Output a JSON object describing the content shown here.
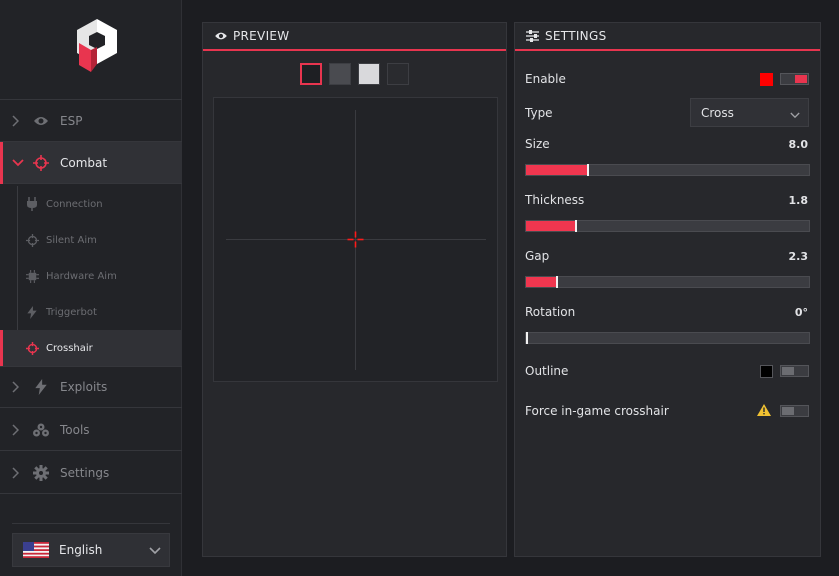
{
  "sidebar": {
    "nav": [
      {
        "label": "ESP",
        "icon": "eye-icon"
      },
      {
        "label": "Combat",
        "icon": "crosshair-icon"
      },
      {
        "label": "Exploits",
        "icon": "lightning-icon"
      },
      {
        "label": "Tools",
        "icon": "tools-icon"
      },
      {
        "label": "Settings",
        "icon": "gear-icon"
      }
    ],
    "combat_sub": [
      {
        "label": "Connection",
        "icon": "plug-icon"
      },
      {
        "label": "Silent Aim",
        "icon": "target-icon"
      },
      {
        "label": "Hardware Aim",
        "icon": "chip-icon"
      },
      {
        "label": "Triggerbot",
        "icon": "lightning-icon"
      },
      {
        "label": "Crosshair",
        "icon": "crosshair-icon"
      }
    ],
    "language": {
      "label": "English",
      "flag": "us-flag-icon"
    }
  },
  "preview": {
    "title": "PREVIEW",
    "background_swatches": [
      "#1e1f23",
      "#4a4b50",
      "#d9d9dc",
      "#2a2b2f"
    ],
    "selected_swatch": 0
  },
  "settings": {
    "title": "SETTINGS",
    "enable": {
      "label": "Enable",
      "color": "#ff0000",
      "on": true
    },
    "type": {
      "label": "Type",
      "value": "Cross"
    },
    "size": {
      "label": "Size",
      "value": "8.0",
      "fraction": 0.22
    },
    "thickness": {
      "label": "Thickness",
      "value": "1.8",
      "fraction": 0.175
    },
    "gap": {
      "label": "Gap",
      "value": "2.3",
      "fraction": 0.11
    },
    "rotation": {
      "label": "Rotation",
      "value": "0°",
      "fraction": 0.0
    },
    "outline": {
      "label": "Outline",
      "color": "#000000",
      "on": false
    },
    "force_ingame": {
      "label": "Force in-game crosshair",
      "on": false,
      "warning_icon": "warning-icon"
    }
  },
  "colors": {
    "accent": "#e8354f",
    "crosshair": "#ff1a1a"
  }
}
